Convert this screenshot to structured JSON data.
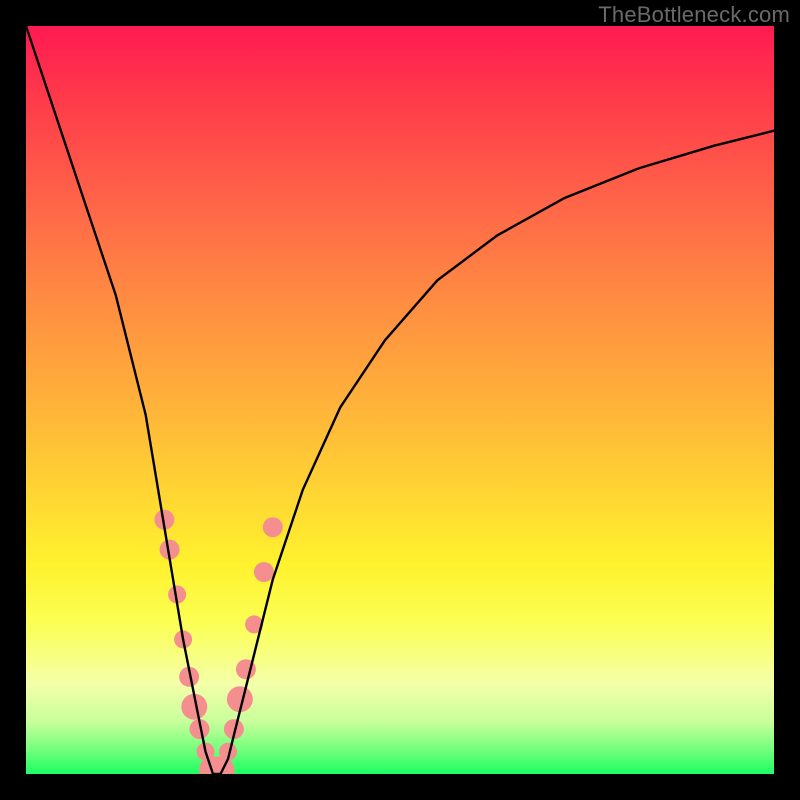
{
  "watermark": "TheBottleneck.com",
  "chart_data": {
    "type": "line",
    "title": "",
    "xlabel": "",
    "ylabel": "",
    "xlim": [
      0,
      100
    ],
    "ylim": [
      0,
      100
    ],
    "series": [
      {
        "name": "bottleneck-curve",
        "x": [
          0,
          4,
          8,
          12,
          16,
          19,
          21,
          23,
          24,
          25,
          26,
          27,
          28,
          30,
          33,
          37,
          42,
          48,
          55,
          63,
          72,
          82,
          92,
          100
        ],
        "values": [
          100,
          88,
          76,
          64,
          48,
          30,
          18,
          8,
          3,
          0,
          0,
          2,
          6,
          14,
          26,
          38,
          49,
          58,
          66,
          72,
          77,
          81,
          84,
          86
        ]
      }
    ],
    "markers": {
      "name": "highlight-beads",
      "x": [
        18.5,
        19.2,
        20.2,
        21.0,
        21.8,
        22.5,
        23.2,
        24.0,
        25.0,
        26.0,
        27.0,
        27.8,
        28.6,
        29.4,
        30.5,
        31.8,
        33.0
      ],
      "values": [
        34,
        30,
        24,
        18,
        13,
        9,
        6,
        3,
        0.5,
        0.5,
        3,
        6,
        10,
        14,
        20,
        27,
        33
      ],
      "sizes": [
        10,
        10,
        9,
        9,
        10,
        13,
        10,
        9,
        14,
        14,
        9,
        10,
        13,
        10,
        9,
        10,
        10
      ]
    },
    "colors": {
      "curve": "#000000",
      "markers": "#f58f8f",
      "gradient_top": "#ff1a52",
      "gradient_bottom": "#1bff62"
    }
  }
}
